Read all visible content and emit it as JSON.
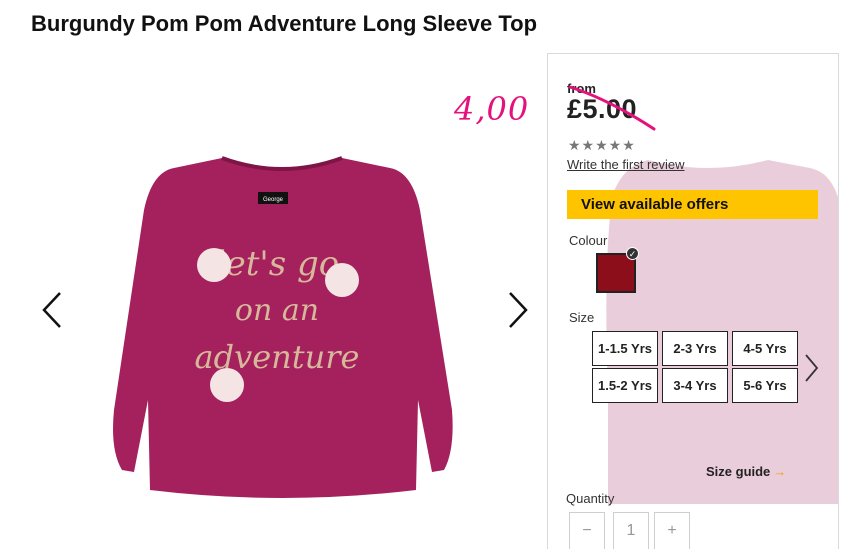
{
  "page": {
    "title": "Burgundy Pom Pom Adventure Long Sleeve Top"
  },
  "gallery": {
    "prev_icon": "chevron-left-icon",
    "next_icon": "chevron-right-icon",
    "print_lines": [
      "let's go",
      "on an",
      "adventure"
    ],
    "neck_label": "George"
  },
  "product": {
    "from_label": "from",
    "price": "£5.00",
    "handwritten_price": "4,00",
    "rating_stars": 0,
    "rating_max": 5,
    "review_link": "Write the first review",
    "offers_button": "View available offers",
    "colour_label": "Colour",
    "colours": [
      {
        "name": "Burgundy",
        "hex": "#8b0e1a",
        "selected": true
      }
    ],
    "size_label": "Size",
    "sizes": [
      "1-1.5 Yrs",
      "2-3 Yrs",
      "4-5 Yrs",
      "1.5-2 Yrs",
      "3-4 Yrs",
      "5-6 Yrs"
    ],
    "size_guide": "Size guide",
    "quantity_label": "Quantity",
    "quantity_value": "1",
    "minus": "−",
    "plus": "+"
  },
  "colors": {
    "accent_yellow": "#ffc400",
    "shirt": "#a4215e",
    "annotation_pink": "#e4127a"
  }
}
